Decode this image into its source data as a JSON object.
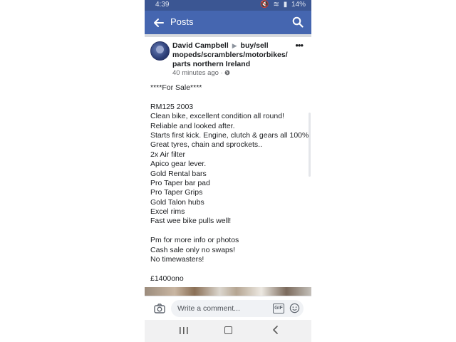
{
  "status_bar": {
    "time": "4:39",
    "icons": [
      "mute-icon",
      "wifi-icon",
      "signal-icon"
    ],
    "battery": "14%"
  },
  "app_bar": {
    "title": "Posts"
  },
  "post": {
    "author": "David Campbell",
    "group": "buy/sell mopeds/scramblers/motorbikes/ parts northern Ireland",
    "timestamp": "40 minutes ago",
    "privacy_separator": "·",
    "body_lines": [
      "****For Sale****",
      "",
      "RM125 2003",
      "Clean bike, excellent condition all round!",
      "Reliable and looked after.",
      "Starts first kick. Engine, clutch & gears all 100%",
      "Great tyres, chain and sprockets..",
      "2x Air filter",
      "Apico gear lever.",
      "Gold Rental bars",
      "Pro Taper bar pad",
      "Pro Taper Grips",
      "Gold Talon hubs",
      "Excel rims",
      "Fast wee bike pulls well!",
      "",
      "Pm for more info or photos",
      "Cash sale only no swaps!",
      "No timewasters!",
      "",
      "£1400ono"
    ]
  },
  "comment_bar": {
    "placeholder": "Write a comment...",
    "gif_label": "GIF"
  },
  "colors": {
    "status_bar": "#3b5693",
    "app_bar": "#4566b0",
    "text": "#1c1e21",
    "meta": "#65676b"
  }
}
